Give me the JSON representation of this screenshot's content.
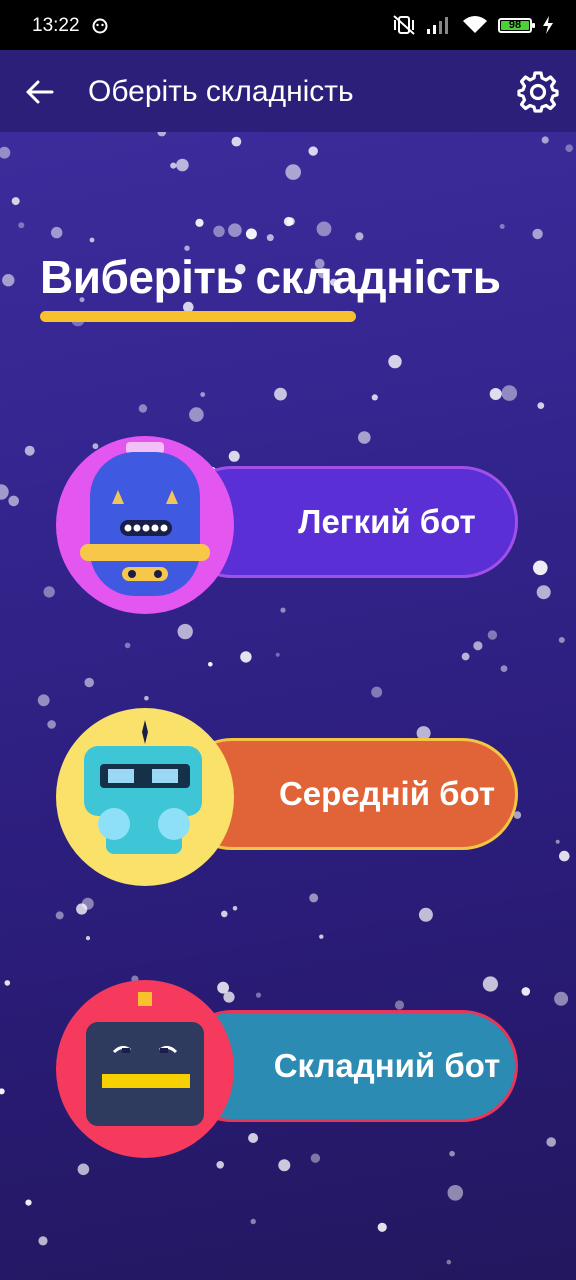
{
  "status_bar": {
    "time": "13:22",
    "battery": "98"
  },
  "app_bar": {
    "title": "Оберіть складність"
  },
  "heading": {
    "text": "Виберіть складність",
    "underline_color": "#f7c02d"
  },
  "bots": [
    {
      "label": "Легкий бот",
      "pill_color": "#5a2fd6",
      "pill_border": "#a04fe8",
      "avatar_color": "#e456f0",
      "icon": "easy-robot-icon"
    },
    {
      "label": "Середній бот",
      "pill_color": "#e06437",
      "pill_border": "#f4c542",
      "avatar_color": "#f9e16a",
      "icon": "medium-robot-icon"
    },
    {
      "label": "Складний бот",
      "pill_color": "#2c8bb3",
      "pill_border": "#e8355a",
      "avatar_color": "#f53a5d",
      "icon": "hard-robot-icon"
    }
  ]
}
